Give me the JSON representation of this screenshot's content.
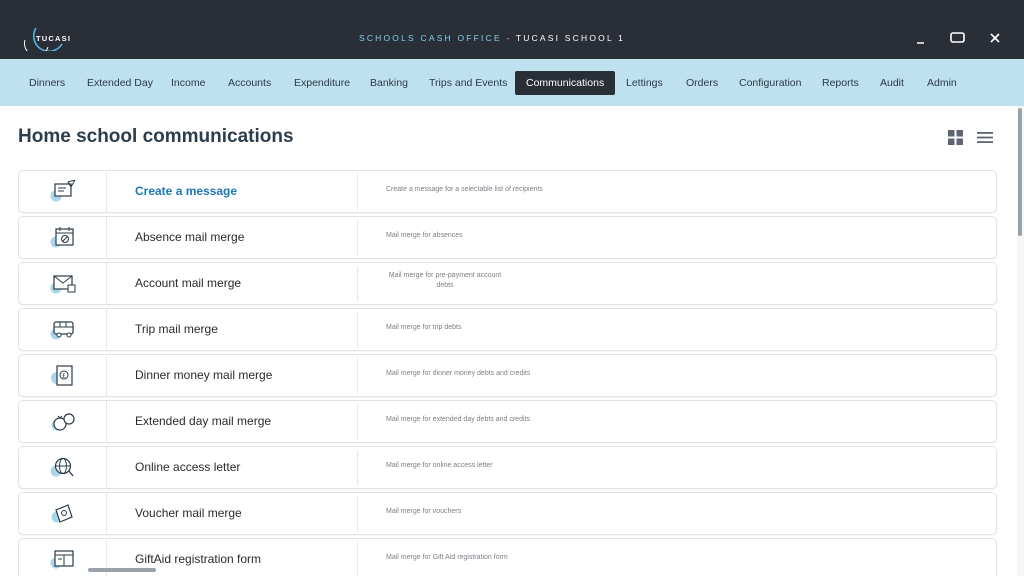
{
  "titlebar": {
    "logo_text": "TUCASI",
    "app_name": "SCHOOLS CASH OFFICE",
    "separator": " - ",
    "school_name": "TUCASI SCHOOL 1",
    "minimize_icon": "minimize-icon",
    "maximize_icon": "maximize-icon",
    "close_icon": "close-icon"
  },
  "nav": {
    "items": [
      {
        "label": "Dinners"
      },
      {
        "label": "Extended Day"
      },
      {
        "label": "Income"
      },
      {
        "label": "Accounts"
      },
      {
        "label": "Expenditure"
      },
      {
        "label": "Banking"
      },
      {
        "label": "Trips and Events"
      },
      {
        "label": "Communications",
        "active": true
      },
      {
        "label": "Lettings"
      },
      {
        "label": "Orders"
      },
      {
        "label": "Configuration"
      },
      {
        "label": "Reports"
      },
      {
        "label": "Audit"
      },
      {
        "label": "Admin"
      }
    ]
  },
  "page": {
    "title": "Home school communications",
    "view_icons": [
      "grid-view-icon",
      "list-view-icon"
    ]
  },
  "cards": [
    {
      "title": "Create a message",
      "description": "Create a message for a selectable list of recipients",
      "icon": "compose-message-icon"
    },
    {
      "title": "Absence mail merge",
      "description": "Mail merge for absences",
      "icon": "calendar-absence-icon"
    },
    {
      "title": "Account mail merge",
      "description": "Mail merge for pre-payment account debts",
      "icon": "envelope-account-icon"
    },
    {
      "title": "Trip mail merge",
      "description": "Mail merge for trip debts",
      "icon": "bus-icon"
    },
    {
      "title": "Dinner money mail merge",
      "description": "Mail merge for dinner money debts and credits",
      "icon": "dinner-money-icon"
    },
    {
      "title": "Extended day mail merge",
      "description": "Mail merge for extended day debts and credits",
      "icon": "money-bag-icon"
    },
    {
      "title": "Online access letter",
      "description": "Mail merge for online access letter",
      "icon": "globe-icon"
    },
    {
      "title": "Voucher mail merge",
      "description": "Mail merge for vouchers",
      "icon": "voucher-icon"
    },
    {
      "title": "GiftAid registration form",
      "description": "Mail merge for Gift Aid registration form",
      "icon": "giftaid-form-icon"
    }
  ],
  "colors": {
    "titlebar_bg": "#2a2e37",
    "navbar_bg": "#bfe0ee",
    "accent_link": "#1c79b3",
    "icon_blue": "#a9d4ea"
  }
}
